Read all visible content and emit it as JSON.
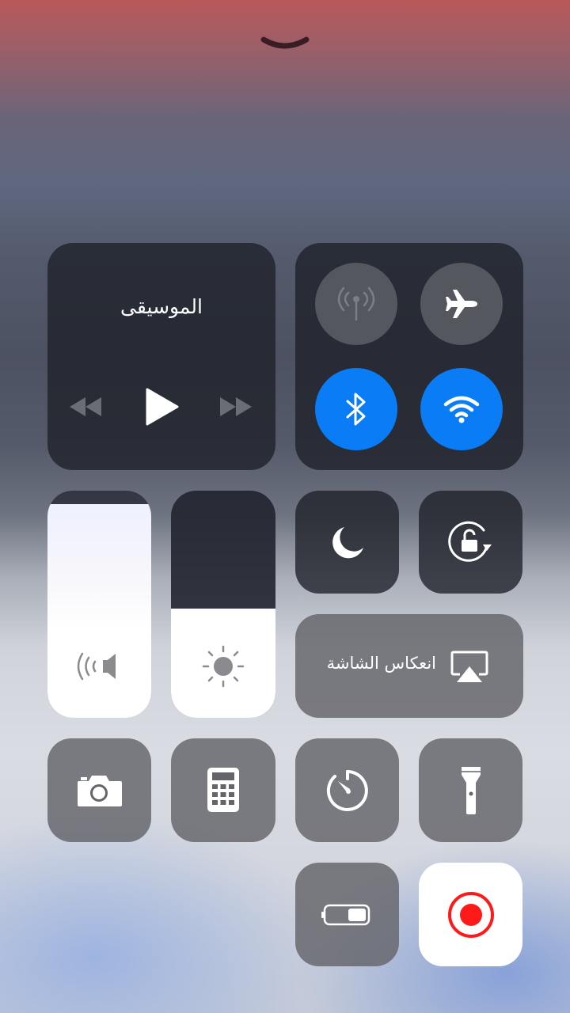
{
  "header": {
    "dismiss_icon": "chevron-down-icon"
  },
  "now_playing": {
    "title": "الموسيقى",
    "controls": [
      "rewind-icon",
      "play-icon",
      "fast-forward-icon"
    ]
  },
  "connectivity": {
    "cellular": {
      "icon": "antenna-icon",
      "state": "off"
    },
    "airplane": {
      "icon": "airplane-icon",
      "state": "off"
    },
    "bluetooth": {
      "icon": "bluetooth-icon",
      "state": "on"
    },
    "wifi": {
      "icon": "wifi-icon",
      "state": "on"
    }
  },
  "sliders": {
    "volume": {
      "icon": "speaker-icon",
      "level": 0.94
    },
    "brightness": {
      "icon": "sun-icon",
      "level": 0.48
    }
  },
  "toggles": {
    "do_not_disturb": {
      "icon": "moon-icon"
    },
    "orientation_lock": {
      "icon": "rotation-lock-icon"
    }
  },
  "screen_mirroring": {
    "label": "انعكاس الشاشة",
    "icon": "airplay-icon"
  },
  "shortcuts": [
    {
      "name": "camera",
      "icon": "camera-icon"
    },
    {
      "name": "calculator",
      "icon": "calculator-icon"
    },
    {
      "name": "timer",
      "icon": "timer-icon"
    },
    {
      "name": "flashlight",
      "icon": "flashlight-icon"
    },
    {
      "name": "low-power",
      "icon": "battery-icon"
    },
    {
      "name": "screen-record",
      "icon": "record-icon"
    }
  ],
  "colors": {
    "accent": "#0a7cf5",
    "record": "#ff1a1a"
  }
}
